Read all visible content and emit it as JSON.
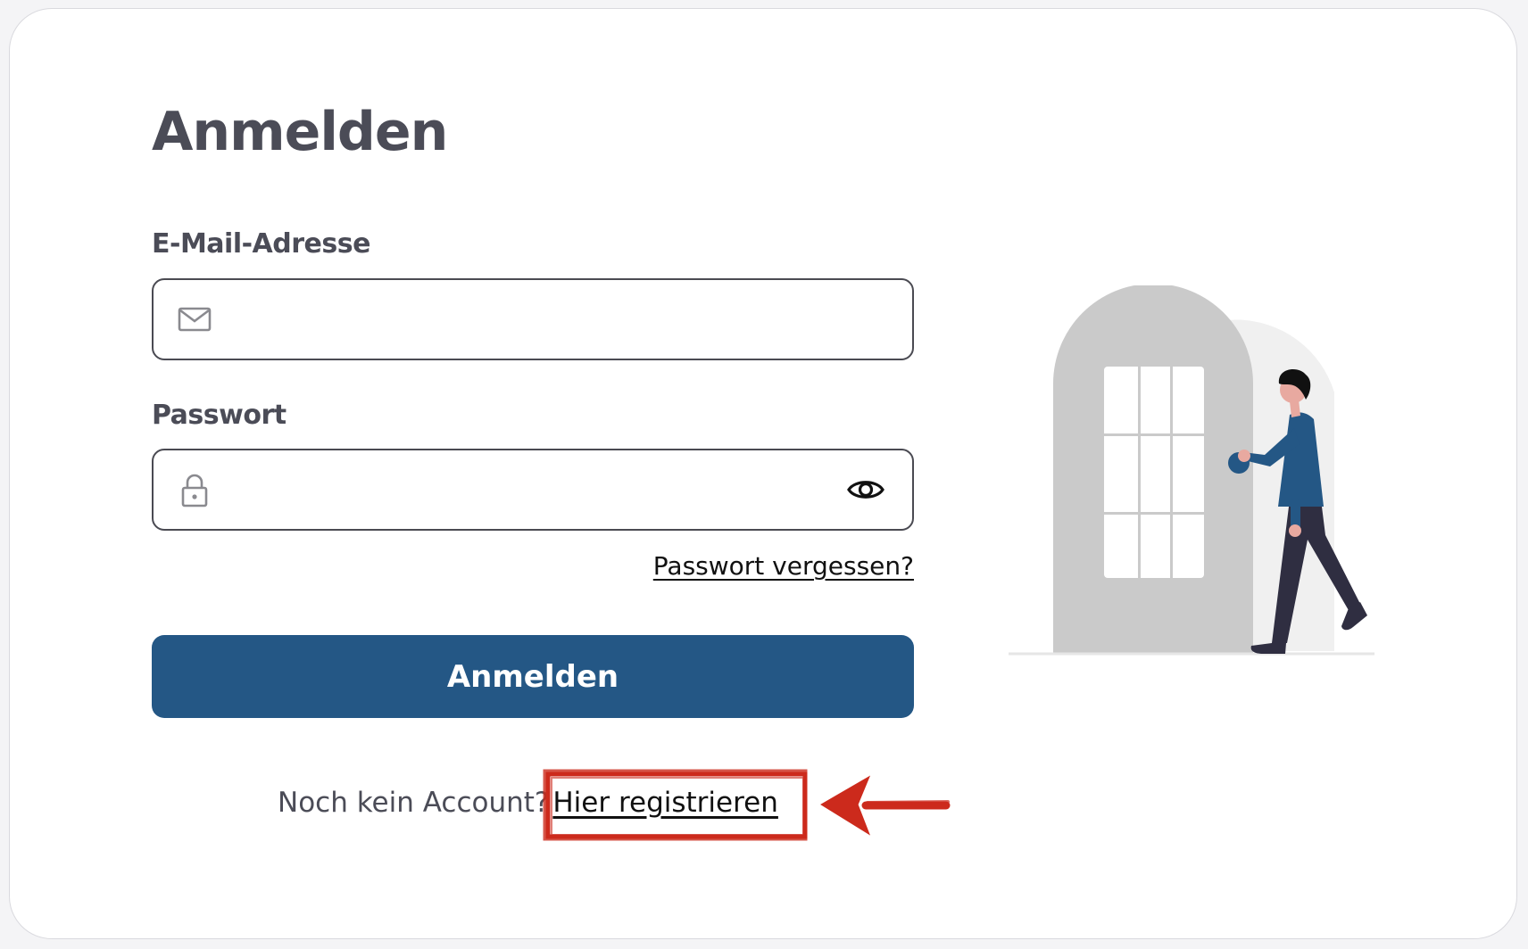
{
  "page": {
    "title": "Anmelden"
  },
  "form": {
    "email": {
      "label": "E-Mail-Adresse",
      "value": "",
      "placeholder": "",
      "icon": "mail-icon"
    },
    "password": {
      "label": "Passwort",
      "value": "",
      "placeholder": "",
      "icon": "lock-icon",
      "toggle_icon": "eye-icon"
    },
    "forgot_link": "Passwort vergessen?",
    "submit_label": "Anmelden"
  },
  "signup": {
    "prompt": "Noch kein Account?",
    "link": "Hier registrieren"
  },
  "colors": {
    "primary": "#245785",
    "text": "#4b4c57",
    "annotation": "#cc2a1c",
    "door": "#cacaca"
  }
}
